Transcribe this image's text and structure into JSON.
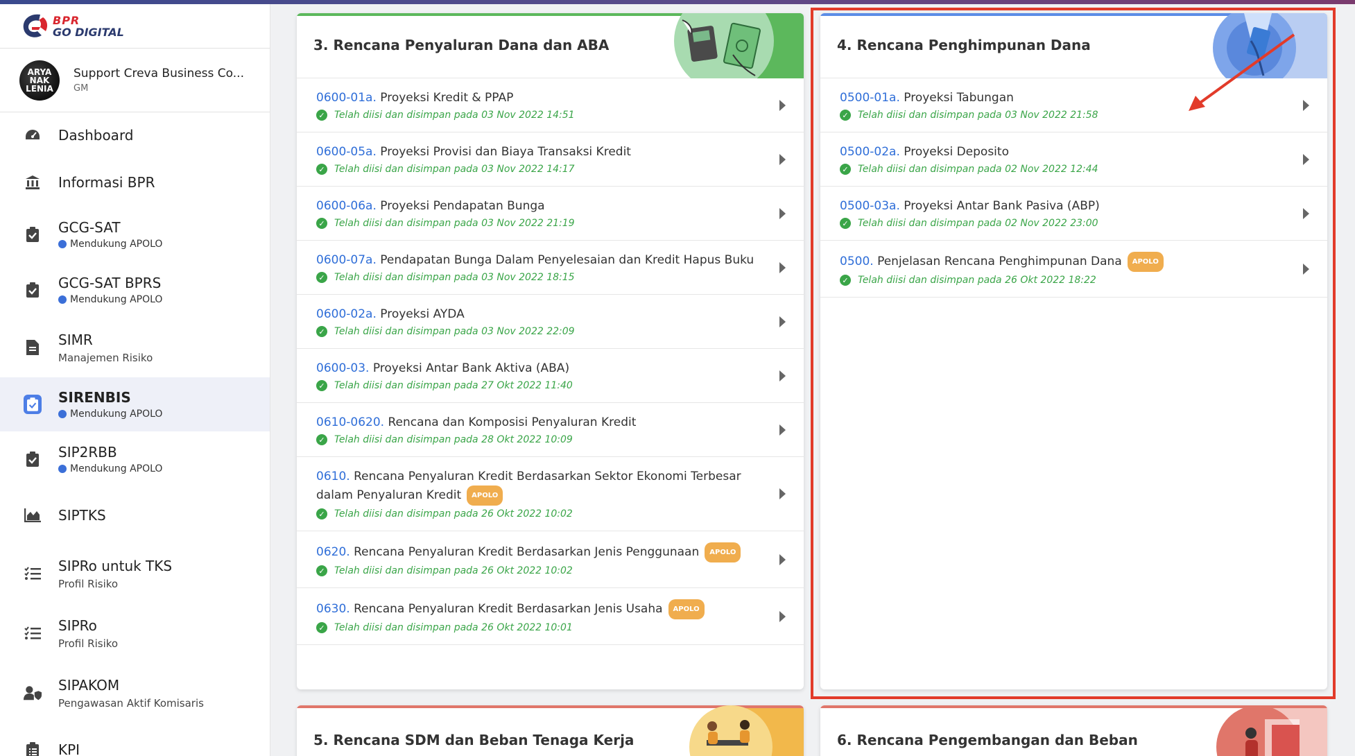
{
  "logo": {
    "line1": "BPR",
    "line2": "GO DIGITAL"
  },
  "user": {
    "avatar_text": "ARYA NAK LENIA",
    "name": "Support Creva Business Co...",
    "role": "GM"
  },
  "sidebar": {
    "items": [
      {
        "label": "Dashboard",
        "icon": "dashboard-icon"
      },
      {
        "label": "Informasi BPR",
        "icon": "bank-icon"
      },
      {
        "label": "GCG-SAT",
        "badge": "Mendukung APOLO",
        "icon": "clipboard-check-icon"
      },
      {
        "label": "GCG-SAT BPRS",
        "badge": "Mendukung APOLO",
        "icon": "clipboard-check-icon"
      },
      {
        "label": "SIMR",
        "sub": "Manajemen Risiko",
        "icon": "document-icon"
      },
      {
        "label": "SIRENBIS",
        "badge": "Mendukung APOLO",
        "icon": "clipboard-check-icon",
        "active": true
      },
      {
        "label": "SIP2RBB",
        "badge": "Mendukung APOLO",
        "icon": "clipboard-check-icon"
      },
      {
        "label": "SIPTKS",
        "icon": "area-chart-icon"
      },
      {
        "label": "SIPRo untuk TKS",
        "sub": "Profil Risiko",
        "icon": "checklist-icon"
      },
      {
        "label": "SIPRo",
        "sub": "Profil Risiko",
        "icon": "checklist-icon"
      },
      {
        "label": "SIPAKOM",
        "sub": "Pengawasan Aktif Komisaris",
        "icon": "user-shield-icon"
      },
      {
        "label": "KPI",
        "icon": "clipboard-list-icon"
      }
    ]
  },
  "cards": {
    "card3": {
      "title": "3. Rencana Penyaluran Dana dan ABA",
      "accent": "#5cb85c",
      "rows": [
        {
          "code": "0600-01a.",
          "title": " Proyeksi Kredit & PPAP",
          "status": "Telah diisi dan disimpan pada 03 Nov 2022 14:51"
        },
        {
          "code": "0600-05a.",
          "title": " Proyeksi Provisi dan Biaya Transaksi Kredit",
          "status": "Telah diisi dan disimpan pada 03 Nov 2022 14:17"
        },
        {
          "code": "0600-06a.",
          "title": " Proyeksi Pendapatan Bunga",
          "status": "Telah diisi dan disimpan pada 03 Nov 2022 21:19"
        },
        {
          "code": "0600-07a.",
          "title": " Pendapatan Bunga Dalam Penyelesaian dan Kredit Hapus Buku",
          "status": "Telah diisi dan disimpan pada 03 Nov 2022 18:15"
        },
        {
          "code": "0600-02a.",
          "title": " Proyeksi AYDA",
          "status": "Telah diisi dan disimpan pada 03 Nov 2022 22:09"
        },
        {
          "code": "0600-03.",
          "title": " Proyeksi Antar Bank Aktiva (ABA)",
          "status": "Telah diisi dan disimpan pada 27 Okt 2022 11:40"
        },
        {
          "code": "0610-0620.",
          "title": " Rencana dan Komposisi Penyaluran Kredit",
          "status": "Telah diisi dan disimpan pada 28 Okt 2022 10:09"
        },
        {
          "code": "0610.",
          "title": " Rencana Penyaluran Kredit Berdasarkan Sektor Ekonomi Terbesar dalam Penyaluran Kredit",
          "badge": "APOLO",
          "status": "Telah diisi dan disimpan pada 26 Okt 2022 10:02"
        },
        {
          "code": "0620.",
          "title": " Rencana Penyaluran Kredit Berdasarkan Jenis Penggunaan",
          "badge": "APOLO",
          "status": "Telah diisi dan disimpan pada 26 Okt 2022 10:02"
        },
        {
          "code": "0630.",
          "title": " Rencana Penyaluran Kredit Berdasarkan Jenis Usaha",
          "badge": "APOLO",
          "status": "Telah diisi dan disimpan pada 26 Okt 2022 10:01"
        }
      ]
    },
    "card4": {
      "title": "4. Rencana Penghimpunan Dana",
      "accent": "#5b8de6",
      "rows": [
        {
          "code": "0500-01a.",
          "title": " Proyeksi Tabungan",
          "status": "Telah diisi dan disimpan pada 03 Nov 2022 21:58"
        },
        {
          "code": "0500-02a.",
          "title": " Proyeksi Deposito",
          "status": "Telah diisi dan disimpan pada 02 Nov 2022 12:44"
        },
        {
          "code": "0500-03a.",
          "title": " Proyeksi Antar Bank Pasiva (ABP)",
          "status": "Telah diisi dan disimpan pada 02 Nov 2022 23:00"
        },
        {
          "code": "0500.",
          "title": " Penjelasan Rencana Penghimpunan Dana",
          "badge": "APOLO",
          "status": "Telah diisi dan disimpan pada 26 Okt 2022 18:22"
        }
      ]
    },
    "card5": {
      "title": "5. Rencana SDM dan Beban Tenaga Kerja",
      "accent": "#e0766a"
    },
    "card6": {
      "title": "6. Rencana Pengembangan dan Beban",
      "accent": "#e0766a"
    }
  },
  "colors": {
    "highlight": "#e23b2a",
    "code_blue": "#2f6ed8",
    "status_green": "#3aa548",
    "badge_orange": "#f0ad4e"
  }
}
